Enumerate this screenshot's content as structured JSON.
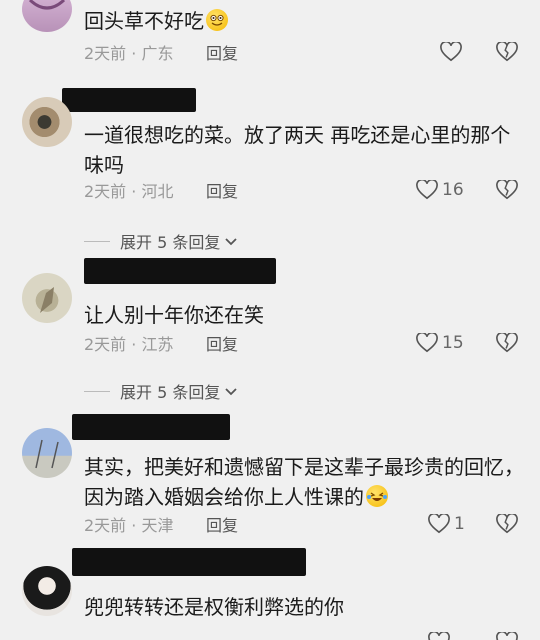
{
  "comments": [
    {
      "text": "回头草不好吃",
      "time": "2天前",
      "location": "广东",
      "reply_label": "回复",
      "likes": "",
      "emoji": "grinning-emoji"
    },
    {
      "text": "一道很想吃的菜。放了两天  再吃还是心里的那个味吗",
      "time": "2天前",
      "location": "河北",
      "reply_label": "回复",
      "likes": "16",
      "expand_label": "展开 5 条回复"
    },
    {
      "text": "让人别十年你还在笑",
      "time": "2天前",
      "location": "江苏",
      "reply_label": "回复",
      "likes": "15",
      "expand_label": "展开 5 条回复"
    },
    {
      "text": "其实，把美好和遗憾留下是这辈子最珍贵的回忆，因为踏入婚姻会给你上人性课的",
      "time": "2天前",
      "location": "天津",
      "reply_label": "回复",
      "likes": "1",
      "emoji": "laughing-tears-emoji"
    },
    {
      "text": "兜兜转转还是权衡利弊选的你"
    }
  ],
  "separator": " · ",
  "colors": {
    "background": "#f0f0f0",
    "meta": "#999999",
    "text": "#1a1a1a",
    "redaction": "#111111"
  }
}
